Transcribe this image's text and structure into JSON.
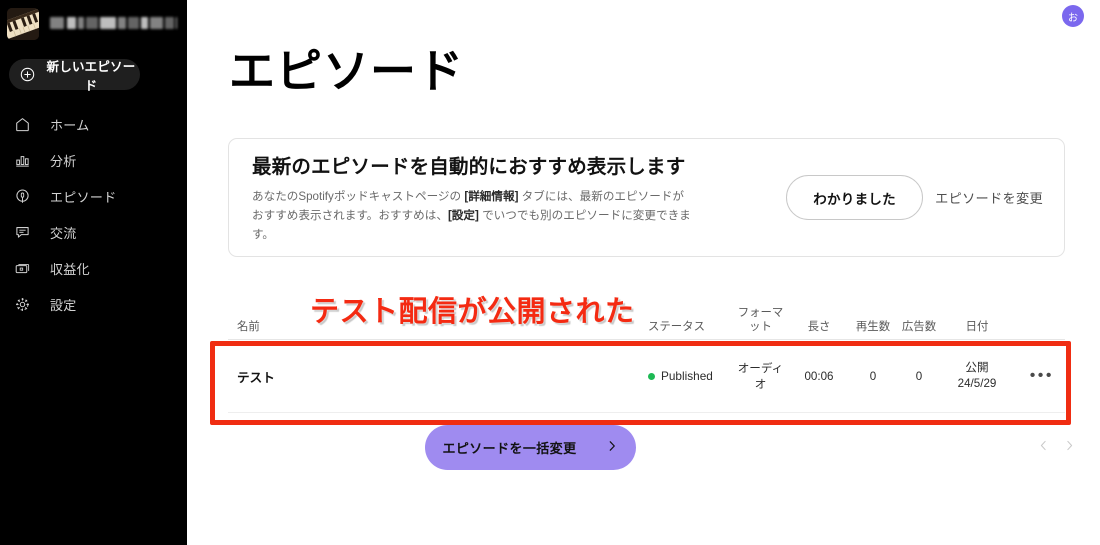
{
  "sidebar": {
    "brand": {
      "thumbnail_icon": "piano-keyboard-thumbnail",
      "title_redacted": true
    },
    "new_episode": {
      "label": "新しいエピソード",
      "icon": "plus-circle-icon"
    },
    "items": [
      {
        "label": "ホーム",
        "icon": "home-icon"
      },
      {
        "label": "分析",
        "icon": "bar-chart-icon"
      },
      {
        "label": "エピソード",
        "icon": "microphone-circle-icon"
      },
      {
        "label": "交流",
        "icon": "speech-bubble-icon"
      },
      {
        "label": "収益化",
        "icon": "money-card-icon"
      },
      {
        "label": "設定",
        "icon": "gear-icon"
      }
    ]
  },
  "header": {
    "avatar_initial": "お"
  },
  "main": {
    "page_title": "エピソード"
  },
  "notice": {
    "heading": "最新のエピソードを自動的におすすめ表示します",
    "body_line1_a": "あなたのSpotifyポッドキャストページの ",
    "body_line1_b": "[詳細情報]",
    "body_line1_c": " タブには、最新のエピソードが",
    "body_line2_a": "おすすめ表示されます。おすすめは、",
    "body_line2_b": "[設定]",
    "body_line2_c": " でいつでも別のエピソードに変更できます。",
    "ok_button": "わかりました",
    "change_link": "エピソードを変更"
  },
  "table": {
    "columns": {
      "name": "名前",
      "status": "ステータス",
      "format": "フォーマット",
      "length": "長さ",
      "plays": "再生数",
      "ads": "広告数",
      "date": "日付"
    },
    "rows": [
      {
        "name": "テスト",
        "status": "Published",
        "status_color": "#1db954",
        "format": "オーディオ",
        "length": "00:06",
        "plays": "0",
        "ads": "0",
        "date_label": "公開",
        "date_value": "24/5/29",
        "more_icon": "ellipsis-icon"
      }
    ]
  },
  "footer": {
    "bulk_edit_label": "エピソードを一括変更",
    "bulk_edit_icon": "chevron-right-icon",
    "bulk_edit_color": "#9f8bf0",
    "pager_prev_icon": "chevron-left-icon",
    "pager_next_icon": "chevron-right-icon"
  },
  "annotations": {
    "callout_text": "テスト配信が公開された",
    "callout_color": "#f42a12",
    "highlight_box_color": "#f02d12"
  }
}
